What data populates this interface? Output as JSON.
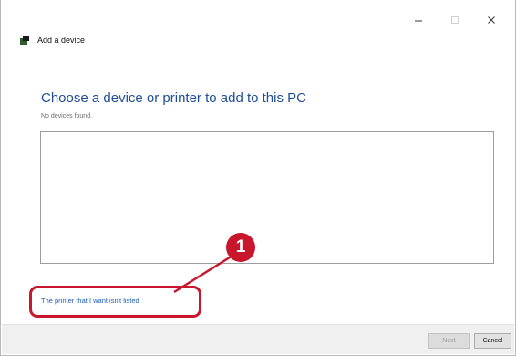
{
  "window": {
    "controls": {
      "minimize_icon": "minimize-icon",
      "maximize_icon": "maximize-icon",
      "close_icon": "close-icon"
    }
  },
  "header": {
    "icon": "add-device-icon",
    "title": "Add a device"
  },
  "main": {
    "heading": "Choose a device or printer to add to this PC",
    "status": "No devices found.",
    "device_list": []
  },
  "callout": {
    "number": "1",
    "color": "#c8172d"
  },
  "link": {
    "printer_not_listed": "The printer that I want isn't listed"
  },
  "footer": {
    "next_label": "Next",
    "cancel_label": "Cancel"
  },
  "colors": {
    "heading": "#1f4e98",
    "link": "#1f5fb3",
    "footer_bg": "#f0f0f0"
  }
}
